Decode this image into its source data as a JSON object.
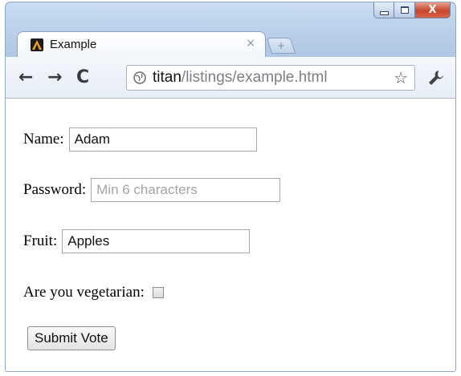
{
  "browser": {
    "tab": {
      "title": "Example",
      "close_glyph": "×"
    },
    "new_tab_glyph": "+",
    "toolbar": {
      "back_glyph": "←",
      "forward_glyph": "→",
      "reload_glyph": "C",
      "url_host": "titan",
      "url_path": "/listings/example.html",
      "star_glyph": "☆"
    },
    "window_controls": {
      "close_glyph": "X"
    }
  },
  "form": {
    "name": {
      "label": "Name:",
      "value": "Adam"
    },
    "password": {
      "label": "Password:",
      "placeholder": "Min 6 characters",
      "value": ""
    },
    "fruit": {
      "label": "Fruit:",
      "value": "Apples"
    },
    "vegetarian": {
      "label": "Are you vegetarian:",
      "checked": false
    },
    "submit_label": "Submit Vote"
  },
  "colors": {
    "window_frame": "#aac3e2",
    "close_button": "#c8452c"
  }
}
